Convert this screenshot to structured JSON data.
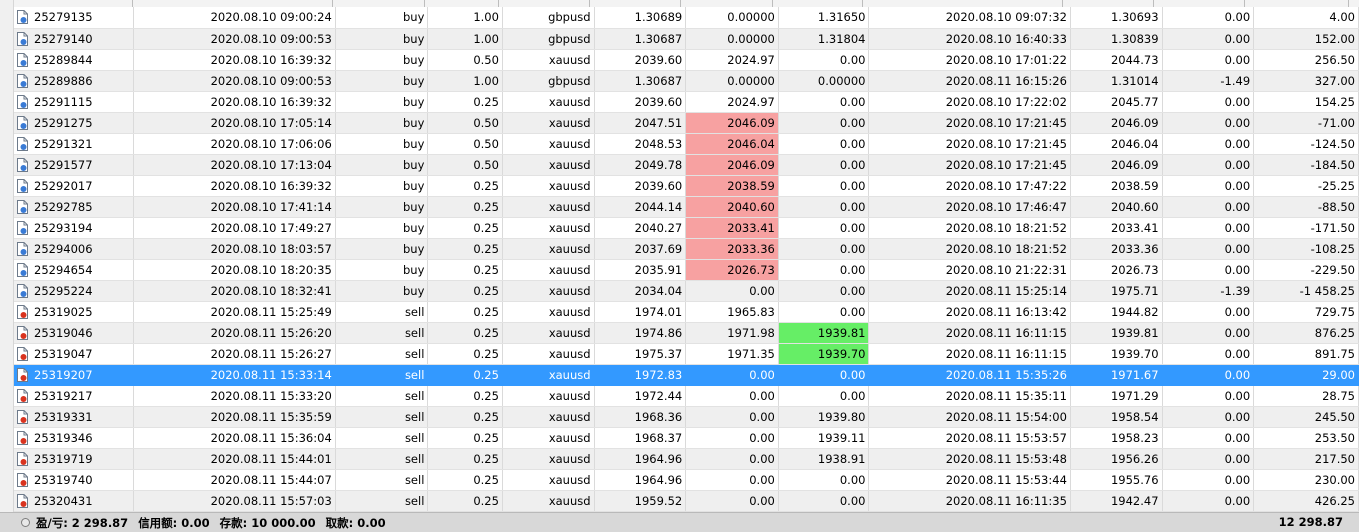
{
  "rows": [
    {
      "ticket": "25279135",
      "open_time": "2020.08.10 09:00:24",
      "type": "buy",
      "size": "1.00",
      "symbol": "gbpusd",
      "open_price": "1.30689",
      "sl": "0.00000",
      "tp": "1.31650",
      "close_time": "2020.08.10 09:07:32",
      "close_price": "1.30693",
      "commission": "0.00",
      "profit": "4.00",
      "icon": "buy-doc-icon"
    },
    {
      "ticket": "25279140",
      "open_time": "2020.08.10 09:00:53",
      "type": "buy",
      "size": "1.00",
      "symbol": "gbpusd",
      "open_price": "1.30687",
      "sl": "0.00000",
      "tp": "1.31804",
      "close_time": "2020.08.10 16:40:33",
      "close_price": "1.30839",
      "commission": "0.00",
      "profit": "152.00",
      "icon": "buy-doc-icon"
    },
    {
      "ticket": "25289844",
      "open_time": "2020.08.10 16:39:32",
      "type": "buy",
      "size": "0.50",
      "symbol": "xauusd",
      "open_price": "2039.60",
      "sl": "2024.97",
      "tp": "0.00",
      "close_time": "2020.08.10 17:01:22",
      "close_price": "2044.73",
      "commission": "0.00",
      "profit": "256.50",
      "icon": "buy-doc-icon"
    },
    {
      "ticket": "25289886",
      "open_time": "2020.08.10 09:00:53",
      "type": "buy",
      "size": "1.00",
      "symbol": "gbpusd",
      "open_price": "1.30687",
      "sl": "0.00000",
      "tp": "0.00000",
      "close_time": "2020.08.11 16:15:26",
      "close_price": "1.31014",
      "commission": "-1.49",
      "profit": "327.00",
      "icon": "buy-doc-icon"
    },
    {
      "ticket": "25291115",
      "open_time": "2020.08.10 16:39:32",
      "type": "buy",
      "size": "0.25",
      "symbol": "xauusd",
      "open_price": "2039.60",
      "sl": "2024.97",
      "tp": "0.00",
      "close_time": "2020.08.10 17:22:02",
      "close_price": "2045.77",
      "commission": "0.00",
      "profit": "154.25",
      "icon": "buy-doc-icon"
    },
    {
      "ticket": "25291275",
      "open_time": "2020.08.10 17:05:14",
      "type": "buy",
      "size": "0.50",
      "symbol": "xauusd",
      "open_price": "2047.51",
      "sl": "2046.09",
      "tp": "0.00",
      "close_time": "2020.08.10 17:21:45",
      "close_price": "2046.09",
      "commission": "0.00",
      "profit": "-71.00",
      "icon": "buy-doc-icon",
      "sl_hl": "red"
    },
    {
      "ticket": "25291321",
      "open_time": "2020.08.10 17:06:06",
      "type": "buy",
      "size": "0.50",
      "symbol": "xauusd",
      "open_price": "2048.53",
      "sl": "2046.04",
      "tp": "0.00",
      "close_time": "2020.08.10 17:21:45",
      "close_price": "2046.04",
      "commission": "0.00",
      "profit": "-124.50",
      "icon": "buy-doc-icon",
      "sl_hl": "red"
    },
    {
      "ticket": "25291577",
      "open_time": "2020.08.10 17:13:04",
      "type": "buy",
      "size": "0.50",
      "symbol": "xauusd",
      "open_price": "2049.78",
      "sl": "2046.09",
      "tp": "0.00",
      "close_time": "2020.08.10 17:21:45",
      "close_price": "2046.09",
      "commission": "0.00",
      "profit": "-184.50",
      "icon": "buy-doc-icon",
      "sl_hl": "red"
    },
    {
      "ticket": "25292017",
      "open_time": "2020.08.10 16:39:32",
      "type": "buy",
      "size": "0.25",
      "symbol": "xauusd",
      "open_price": "2039.60",
      "sl": "2038.59",
      "tp": "0.00",
      "close_time": "2020.08.10 17:47:22",
      "close_price": "2038.59",
      "commission": "0.00",
      "profit": "-25.25",
      "icon": "buy-doc-icon",
      "sl_hl": "red"
    },
    {
      "ticket": "25292785",
      "open_time": "2020.08.10 17:41:14",
      "type": "buy",
      "size": "0.25",
      "symbol": "xauusd",
      "open_price": "2044.14",
      "sl": "2040.60",
      "tp": "0.00",
      "close_time": "2020.08.10 17:46:47",
      "close_price": "2040.60",
      "commission": "0.00",
      "profit": "-88.50",
      "icon": "buy-doc-icon",
      "sl_hl": "red"
    },
    {
      "ticket": "25293194",
      "open_time": "2020.08.10 17:49:27",
      "type": "buy",
      "size": "0.25",
      "symbol": "xauusd",
      "open_price": "2040.27",
      "sl": "2033.41",
      "tp": "0.00",
      "close_time": "2020.08.10 18:21:52",
      "close_price": "2033.41",
      "commission": "0.00",
      "profit": "-171.50",
      "icon": "buy-doc-icon",
      "sl_hl": "red"
    },
    {
      "ticket": "25294006",
      "open_time": "2020.08.10 18:03:57",
      "type": "buy",
      "size": "0.25",
      "symbol": "xauusd",
      "open_price": "2037.69",
      "sl": "2033.36",
      "tp": "0.00",
      "close_time": "2020.08.10 18:21:52",
      "close_price": "2033.36",
      "commission": "0.00",
      "profit": "-108.25",
      "icon": "buy-doc-icon",
      "sl_hl": "red"
    },
    {
      "ticket": "25294654",
      "open_time": "2020.08.10 18:20:35",
      "type": "buy",
      "size": "0.25",
      "symbol": "xauusd",
      "open_price": "2035.91",
      "sl": "2026.73",
      "tp": "0.00",
      "close_time": "2020.08.10 21:22:31",
      "close_price": "2026.73",
      "commission": "0.00",
      "profit": "-229.50",
      "icon": "buy-doc-icon",
      "sl_hl": "red"
    },
    {
      "ticket": "25295224",
      "open_time": "2020.08.10 18:32:41",
      "type": "buy",
      "size": "0.25",
      "symbol": "xauusd",
      "open_price": "2034.04",
      "sl": "0.00",
      "tp": "0.00",
      "close_time": "2020.08.11 15:25:14",
      "close_price": "1975.71",
      "commission": "-1.39",
      "profit": "-1 458.25",
      "icon": "buy-doc-icon"
    },
    {
      "ticket": "25319025",
      "open_time": "2020.08.11 15:25:49",
      "type": "sell",
      "size": "0.25",
      "symbol": "xauusd",
      "open_price": "1974.01",
      "sl": "1965.83",
      "tp": "0.00",
      "close_time": "2020.08.11 16:13:42",
      "close_price": "1944.82",
      "commission": "0.00",
      "profit": "729.75",
      "icon": "sell-doc-icon"
    },
    {
      "ticket": "25319046",
      "open_time": "2020.08.11 15:26:20",
      "type": "sell",
      "size": "0.25",
      "symbol": "xauusd",
      "open_price": "1974.86",
      "sl": "1971.98",
      "tp": "1939.81",
      "close_time": "2020.08.11 16:11:15",
      "close_price": "1939.81",
      "commission": "0.00",
      "profit": "876.25",
      "icon": "sell-doc-icon",
      "tp_hl": "green"
    },
    {
      "ticket": "25319047",
      "open_time": "2020.08.11 15:26:27",
      "type": "sell",
      "size": "0.25",
      "symbol": "xauusd",
      "open_price": "1975.37",
      "sl": "1971.35",
      "tp": "1939.70",
      "close_time": "2020.08.11 16:11:15",
      "close_price": "1939.70",
      "commission": "0.00",
      "profit": "891.75",
      "icon": "sell-doc-icon",
      "tp_hl": "green"
    },
    {
      "ticket": "25319207",
      "open_time": "2020.08.11 15:33:14",
      "type": "sell",
      "size": "0.25",
      "symbol": "xauusd",
      "open_price": "1972.83",
      "sl": "0.00",
      "tp": "0.00",
      "close_time": "2020.08.11 15:35:26",
      "close_price": "1971.67",
      "commission": "0.00",
      "profit": "29.00",
      "icon": "sell-doc-icon",
      "selected": true
    },
    {
      "ticket": "25319217",
      "open_time": "2020.08.11 15:33:20",
      "type": "sell",
      "size": "0.25",
      "symbol": "xauusd",
      "open_price": "1972.44",
      "sl": "0.00",
      "tp": "0.00",
      "close_time": "2020.08.11 15:35:11",
      "close_price": "1971.29",
      "commission": "0.00",
      "profit": "28.75",
      "icon": "sell-doc-icon"
    },
    {
      "ticket": "25319331",
      "open_time": "2020.08.11 15:35:59",
      "type": "sell",
      "size": "0.25",
      "symbol": "xauusd",
      "open_price": "1968.36",
      "sl": "0.00",
      "tp": "1939.80",
      "close_time": "2020.08.11 15:54:00",
      "close_price": "1958.54",
      "commission": "0.00",
      "profit": "245.50",
      "icon": "sell-doc-icon"
    },
    {
      "ticket": "25319346",
      "open_time": "2020.08.11 15:36:04",
      "type": "sell",
      "size": "0.25",
      "symbol": "xauusd",
      "open_price": "1968.37",
      "sl": "0.00",
      "tp": "1939.11",
      "close_time": "2020.08.11 15:53:57",
      "close_price": "1958.23",
      "commission": "0.00",
      "profit": "253.50",
      "icon": "sell-doc-icon"
    },
    {
      "ticket": "25319719",
      "open_time": "2020.08.11 15:44:01",
      "type": "sell",
      "size": "0.25",
      "symbol": "xauusd",
      "open_price": "1964.96",
      "sl": "0.00",
      "tp": "1938.91",
      "close_time": "2020.08.11 15:53:48",
      "close_price": "1956.26",
      "commission": "0.00",
      "profit": "217.50",
      "icon": "sell-doc-icon"
    },
    {
      "ticket": "25319740",
      "open_time": "2020.08.11 15:44:07",
      "type": "sell",
      "size": "0.25",
      "symbol": "xauusd",
      "open_price": "1964.96",
      "sl": "0.00",
      "tp": "0.00",
      "close_time": "2020.08.11 15:53:44",
      "close_price": "1955.76",
      "commission": "0.00",
      "profit": "230.00",
      "icon": "sell-doc-icon"
    },
    {
      "ticket": "25320431",
      "open_time": "2020.08.11 15:57:03",
      "type": "sell",
      "size": "0.25",
      "symbol": "xauusd",
      "open_price": "1959.52",
      "sl": "0.00",
      "tp": "0.00",
      "close_time": "2020.08.11 16:11:35",
      "close_price": "1942.47",
      "commission": "0.00",
      "profit": "426.25",
      "icon": "sell-doc-icon"
    }
  ],
  "status": {
    "summary": "盈/亏: 2 298.87",
    "credit": "信用额: 0.00",
    "deposit": "存款: 10 000.00",
    "withdrawal": "取款: 0.00",
    "total": "12 298.87"
  },
  "colors": {
    "selected_row": "#3399ff",
    "stop_loss_hit": "#f7a1a1",
    "take_profit_hit": "#66ee66",
    "buy_icon_accent": "#3a7bd5",
    "sell_icon_accent": "#d9331f"
  }
}
